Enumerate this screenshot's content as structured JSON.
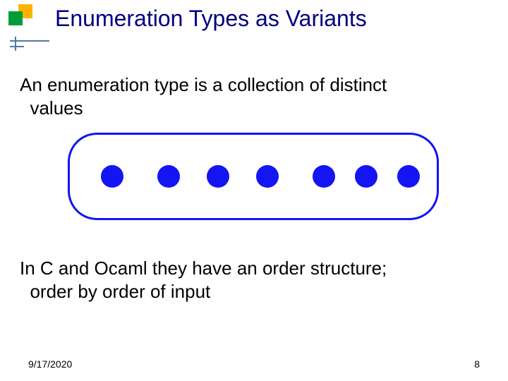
{
  "title": "Enumeration Types as Variants",
  "paragraphs": {
    "p1_line1": "An enumeration type is a collection of distinct",
    "p1_line2": "values",
    "p2_line1": "In C and Ocaml they have an order structure;",
    "p2_line2": "order by order of input"
  },
  "diagram": {
    "dot_count": 7,
    "accent_color": "#1414f4"
  },
  "footer": {
    "date": "9/17/2020",
    "page": "8"
  },
  "deco": {
    "green": "#009e3b",
    "orange": "#ffb300",
    "tick": "#4a7aa5"
  }
}
